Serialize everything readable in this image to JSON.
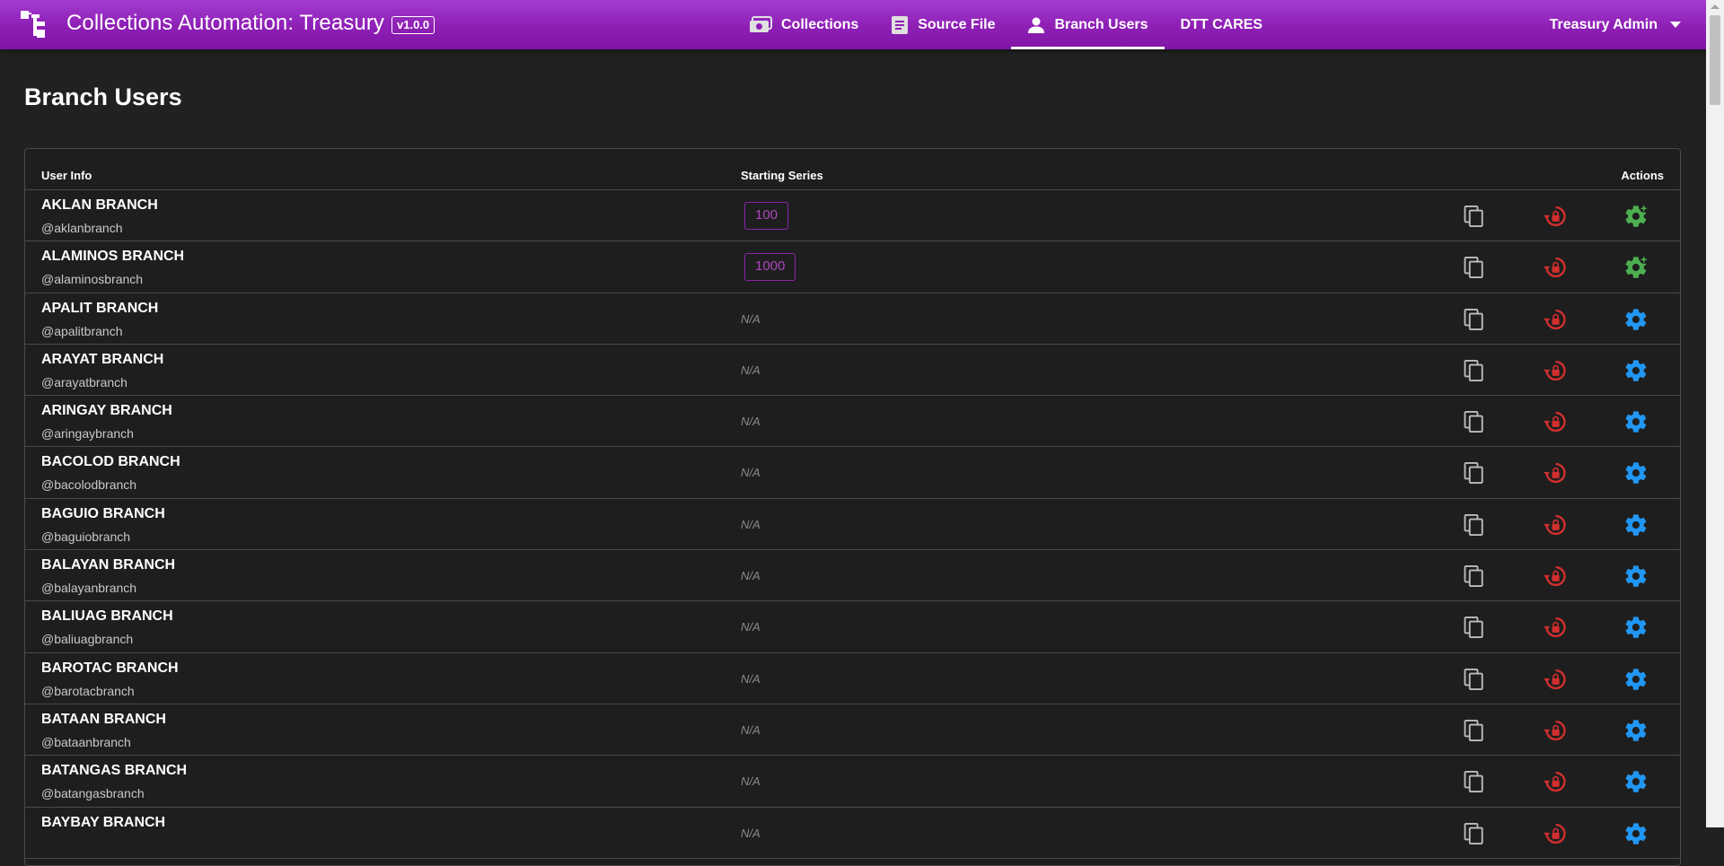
{
  "app": {
    "title": "Collections Automation: Treasury",
    "version": "v1.0.0",
    "logo_icon": "app-logo-icon"
  },
  "nav": {
    "items": [
      {
        "label": "Collections",
        "icon": "money-icon",
        "active": false
      },
      {
        "label": "Source File",
        "icon": "document-icon",
        "active": false
      },
      {
        "label": "Branch Users",
        "icon": "person-icon",
        "active": true
      },
      {
        "label": "DTT CARES",
        "icon": "",
        "active": false
      }
    ]
  },
  "user_menu": {
    "label": "Treasury Admin",
    "icon": "caret-down-icon"
  },
  "page": {
    "title": "Branch Users"
  },
  "table": {
    "headers": {
      "user_info": "User Info",
      "starting_series": "Starting Series",
      "actions": "Actions"
    },
    "rows": [
      {
        "name": "AKLAN BRANCH",
        "handle": "@aklanbranch",
        "series": "100",
        "configured": true
      },
      {
        "name": "ALAMINOS BRANCH",
        "handle": "@alaminosbranch",
        "series": "1000",
        "configured": true
      },
      {
        "name": "APALIT BRANCH",
        "handle": "@apalitbranch",
        "series": "N/A",
        "configured": false
      },
      {
        "name": "ARAYAT BRANCH",
        "handle": "@arayatbranch",
        "series": "N/A",
        "configured": false
      },
      {
        "name": "ARINGAY BRANCH",
        "handle": "@aringaybranch",
        "series": "N/A",
        "configured": false
      },
      {
        "name": "BACOLOD BRANCH",
        "handle": "@bacolodbranch",
        "series": "N/A",
        "configured": false
      },
      {
        "name": "BAGUIO BRANCH",
        "handle": "@baguiobranch",
        "series": "N/A",
        "configured": false
      },
      {
        "name": "BALAYAN BRANCH",
        "handle": "@balayanbranch",
        "series": "N/A",
        "configured": false
      },
      {
        "name": "BALIUAG BRANCH",
        "handle": "@baliuagbranch",
        "series": "N/A",
        "configured": false
      },
      {
        "name": "BAROTAC BRANCH",
        "handle": "@barotacbranch",
        "series": "N/A",
        "configured": false
      },
      {
        "name": "BATAAN BRANCH",
        "handle": "@bataanbranch",
        "series": "N/A",
        "configured": false
      },
      {
        "name": "BATANGAS BRANCH",
        "handle": "@batangasbranch",
        "series": "N/A",
        "configured": false
      },
      {
        "name": "BAYBAY BRANCH",
        "handle": "",
        "series": "N/A",
        "configured": false
      }
    ]
  },
  "colors": {
    "appbar": "#8e1fb5",
    "series_border": "#8e24aa",
    "reset_icon": "#d32f2f",
    "settings_configured": "#4caf50",
    "settings_default": "#2196f3",
    "copy_icon": "#bdbdbd"
  }
}
